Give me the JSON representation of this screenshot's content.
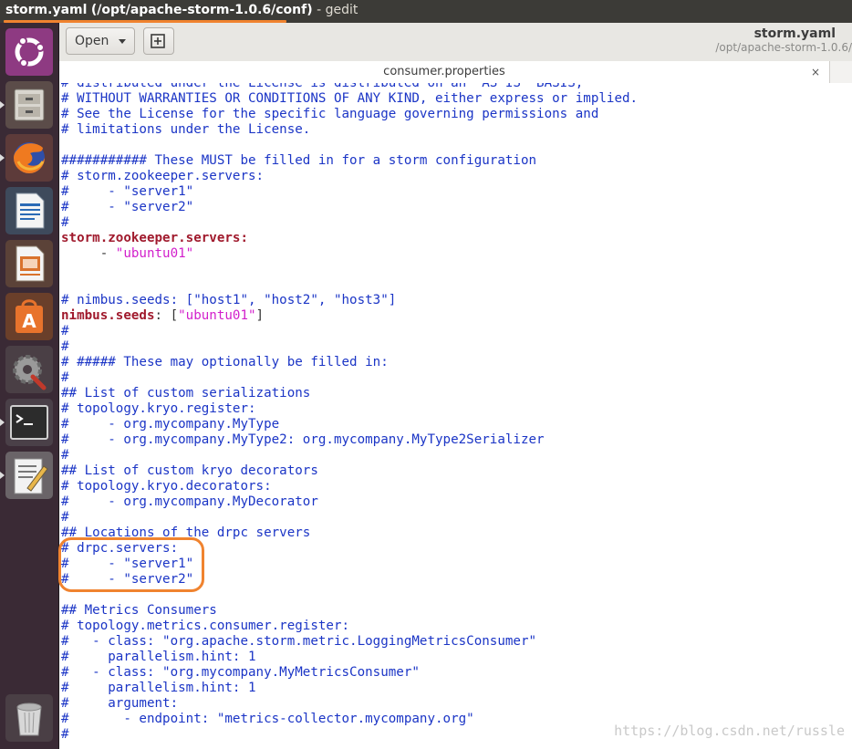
{
  "window": {
    "title_file": "storm.yaml",
    "title_path": "(/opt/apache-storm-1.0.6/conf)",
    "title_app": "- gedit"
  },
  "launcher": {
    "items": [
      {
        "name": "ubuntu-dash",
        "icon": "ubuntu-logo-icon"
      },
      {
        "name": "files",
        "icon": "file-cabinet-icon"
      },
      {
        "name": "firefox",
        "icon": "firefox-icon"
      },
      {
        "name": "writer",
        "icon": "document-writer-icon"
      },
      {
        "name": "impress",
        "icon": "presentation-icon"
      },
      {
        "name": "software",
        "icon": "software-center-icon"
      },
      {
        "name": "settings",
        "icon": "settings-wrench-icon"
      },
      {
        "name": "terminal",
        "icon": "terminal-icon"
      },
      {
        "name": "text-editor",
        "icon": "text-editor-icon"
      },
      {
        "name": "trash",
        "icon": "trash-icon"
      }
    ]
  },
  "header": {
    "open_label": "Open",
    "file_name": "storm.yaml",
    "file_path": "/opt/apache-storm-1.0.6/"
  },
  "tab": {
    "label": "consumer.properties",
    "close": "×"
  },
  "editor": {
    "lines": [
      [
        [
          "c",
          "# distributed under the License is distributed on an \"AS IS\" BASIS,"
        ]
      ],
      [
        [
          "c",
          "# WITHOUT WARRANTIES OR CONDITIONS OF ANY KIND, either express or implied."
        ]
      ],
      [
        [
          "c",
          "# See the License for the specific language governing permissions and"
        ]
      ],
      [
        [
          "c",
          "# limitations under the License."
        ]
      ],
      [],
      [
        [
          "c",
          "########### These MUST be filled in for a storm configuration"
        ]
      ],
      [
        [
          "c",
          "# storm.zookeeper.servers:"
        ]
      ],
      [
        [
          "c",
          "#     - \"server1\""
        ]
      ],
      [
        [
          "c",
          "#     - \"server2\""
        ]
      ],
      [
        [
          "c",
          "#"
        ]
      ],
      [
        [
          "k",
          "storm.zookeeper.servers:"
        ]
      ],
      [
        [
          "p",
          "     - "
        ],
        [
          "s",
          "\"ubuntu01\""
        ]
      ],
      [],
      [],
      [
        [
          "c",
          "# nimbus.seeds: [\"host1\", \"host2\", \"host3\"]"
        ]
      ],
      [
        [
          "k",
          "nimbus.seeds"
        ],
        [
          "p",
          ": ["
        ],
        [
          "s",
          "\"ubuntu01\""
        ],
        [
          "p",
          "]"
        ]
      ],
      [
        [
          "c",
          "#"
        ]
      ],
      [
        [
          "c",
          "#"
        ]
      ],
      [
        [
          "c",
          "# ##### These may optionally be filled in:"
        ]
      ],
      [
        [
          "c",
          "#"
        ]
      ],
      [
        [
          "c",
          "## List of custom serializations"
        ]
      ],
      [
        [
          "c",
          "# topology.kryo.register:"
        ]
      ],
      [
        [
          "c",
          "#     - org.mycompany.MyType"
        ]
      ],
      [
        [
          "c",
          "#     - org.mycompany.MyType2: org.mycompany.MyType2Serializer"
        ]
      ],
      [
        [
          "c",
          "#"
        ]
      ],
      [
        [
          "c",
          "## List of custom kryo decorators"
        ]
      ],
      [
        [
          "c",
          "# topology.kryo.decorators:"
        ]
      ],
      [
        [
          "c",
          "#     - org.mycompany.MyDecorator"
        ]
      ],
      [
        [
          "c",
          "#"
        ]
      ],
      [
        [
          "c",
          "## Locations of the drpc servers"
        ]
      ],
      [
        [
          "c",
          "# drpc.servers:"
        ]
      ],
      [
        [
          "c",
          "#     - \"server1\""
        ]
      ],
      [
        [
          "c",
          "#     - \"server2\""
        ]
      ],
      [],
      [
        [
          "c",
          "## Metrics Consumers"
        ]
      ],
      [
        [
          "c",
          "# topology.metrics.consumer.register:"
        ]
      ],
      [
        [
          "c",
          "#   - class: \"org.apache.storm.metric.LoggingMetricsConsumer\""
        ]
      ],
      [
        [
          "c",
          "#     parallelism.hint: 1"
        ]
      ],
      [
        [
          "c",
          "#   - class: \"org.mycompany.MyMetricsConsumer\""
        ]
      ],
      [
        [
          "c",
          "#     parallelism.hint: 1"
        ]
      ],
      [
        [
          "c",
          "#     argument:"
        ]
      ],
      [
        [
          "c",
          "#       - endpoint: \"metrics-collector.mycompany.org\""
        ]
      ],
      [
        [
          "c",
          "#"
        ]
      ]
    ]
  },
  "watermark": "https://blog.csdn.net/russle",
  "colors": {
    "comment": "#1b35c6",
    "key": "#a01a2d",
    "string": "#d21fcb",
    "highlight": "#f0832f",
    "launcher": "#3a2a35"
  }
}
